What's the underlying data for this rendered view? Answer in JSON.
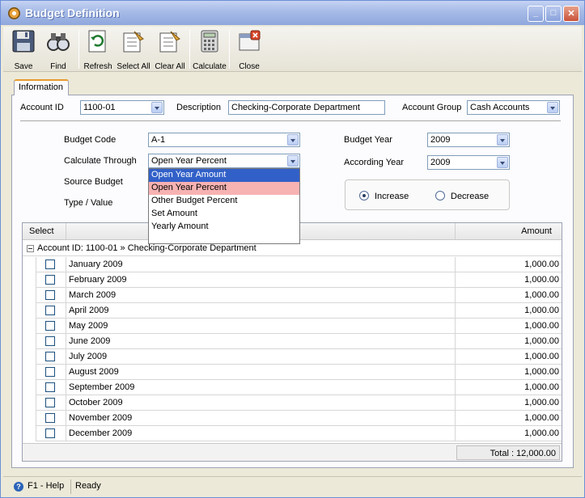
{
  "window": {
    "title": "Budget Definition"
  },
  "toolbar": [
    {
      "id": "save",
      "label": "Save",
      "icon": "save-icon"
    },
    {
      "id": "find",
      "label": "Find",
      "icon": "find-binoculars-icon"
    },
    {
      "id": "refresh",
      "label": "Refresh",
      "icon": "refresh-icon"
    },
    {
      "id": "select_all",
      "label": "Select All",
      "icon": "select-all-icon"
    },
    {
      "id": "clear_all",
      "label": "Clear All",
      "icon": "clear-all-icon"
    },
    {
      "id": "calculate",
      "label": "Calculate",
      "icon": "calculator-icon"
    },
    {
      "id": "close",
      "label": "Close",
      "icon": "close-window-icon"
    }
  ],
  "tabs": {
    "information": "Information"
  },
  "header": {
    "account_id_label": "Account ID",
    "account_id_value": "1100-01",
    "description_label": "Description",
    "description_value": "Checking-Corporate Department",
    "account_group_label": "Account Group",
    "account_group_value": "Cash Accounts"
  },
  "form": {
    "budget_code_label": "Budget Code",
    "budget_code_value": "A-1",
    "calculate_through_label": "Calculate Through",
    "calculate_through_value": "Open Year Percent",
    "source_budget_label": "Source Budget",
    "type_value_label": "Type / Value",
    "budget_year_label": "Budget Year",
    "budget_year_value": "2009",
    "according_year_label": "According Year",
    "according_year_value": "2009",
    "increase_label": "Increase",
    "decrease_label": "Decrease"
  },
  "dropdown": {
    "options": [
      "Open Year Amount",
      "Open Year Percent",
      "Other Budget Percent",
      "Set Amount",
      "Yearly Amount"
    ]
  },
  "grid": {
    "col_select": "Select",
    "col_amount": "Amount",
    "group_label": "Account ID: 1100-01 » Checking-Corporate Department",
    "rows": [
      {
        "month": "January 2009",
        "amount": "1,000.00"
      },
      {
        "month": "February 2009",
        "amount": "1,000.00"
      },
      {
        "month": "March 2009",
        "amount": "1,000.00"
      },
      {
        "month": "April 2009",
        "amount": "1,000.00"
      },
      {
        "month": "May 2009",
        "amount": "1,000.00"
      },
      {
        "month": "June 2009",
        "amount": "1,000.00"
      },
      {
        "month": "July 2009",
        "amount": "1,000.00"
      },
      {
        "month": "August 2009",
        "amount": "1,000.00"
      },
      {
        "month": "September 2009",
        "amount": "1,000.00"
      },
      {
        "month": "October 2009",
        "amount": "1,000.00"
      },
      {
        "month": "November 2009",
        "amount": "1,000.00"
      },
      {
        "month": "December 2009",
        "amount": "1,000.00"
      }
    ],
    "total": "Total : 12,000.00"
  },
  "status": {
    "help": "F1 - Help",
    "state": "Ready"
  }
}
